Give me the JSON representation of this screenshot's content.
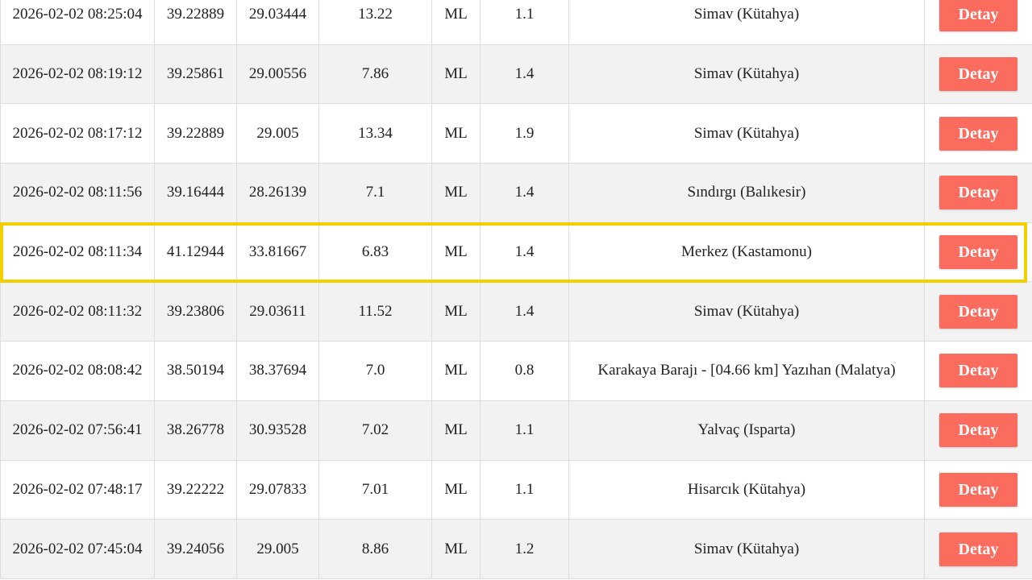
{
  "highlight_color": "#f2d000",
  "button_color": "#fb6b5e",
  "highlighted_row_index": 4,
  "rows": [
    {
      "date": "2026-02-02 08:25:04",
      "lat": "39.22889",
      "lon": "29.03444",
      "depth": "13.22",
      "type": "ML",
      "mag": "1.1",
      "location": "Simav (Kütahya)",
      "action": "Detay"
    },
    {
      "date": "2026-02-02 08:19:12",
      "lat": "39.25861",
      "lon": "29.00556",
      "depth": "7.86",
      "type": "ML",
      "mag": "1.4",
      "location": "Simav (Kütahya)",
      "action": "Detay"
    },
    {
      "date": "2026-02-02 08:17:12",
      "lat": "39.22889",
      "lon": "29.005",
      "depth": "13.34",
      "type": "ML",
      "mag": "1.9",
      "location": "Simav (Kütahya)",
      "action": "Detay"
    },
    {
      "date": "2026-02-02 08:11:56",
      "lat": "39.16444",
      "lon": "28.26139",
      "depth": "7.1",
      "type": "ML",
      "mag": "1.4",
      "location": "Sındırgı (Balıkesir)",
      "action": "Detay"
    },
    {
      "date": "2026-02-02 08:11:34",
      "lat": "41.12944",
      "lon": "33.81667",
      "depth": "6.83",
      "type": "ML",
      "mag": "1.4",
      "location": "Merkez (Kastamonu)",
      "action": "Detay"
    },
    {
      "date": "2026-02-02 08:11:32",
      "lat": "39.23806",
      "lon": "29.03611",
      "depth": "11.52",
      "type": "ML",
      "mag": "1.4",
      "location": "Simav (Kütahya)",
      "action": "Detay"
    },
    {
      "date": "2026-02-02 08:08:42",
      "lat": "38.50194",
      "lon": "38.37694",
      "depth": "7.0",
      "type": "ML",
      "mag": "0.8",
      "location": "Karakaya Barajı - [04.66 km] Yazıhan (Malatya)",
      "action": "Detay"
    },
    {
      "date": "2026-02-02 07:56:41",
      "lat": "38.26778",
      "lon": "30.93528",
      "depth": "7.02",
      "type": "ML",
      "mag": "1.1",
      "location": "Yalvaç (Isparta)",
      "action": "Detay"
    },
    {
      "date": "2026-02-02 07:48:17",
      "lat": "39.22222",
      "lon": "29.07833",
      "depth": "7.01",
      "type": "ML",
      "mag": "1.1",
      "location": "Hisarcık (Kütahya)",
      "action": "Detay"
    },
    {
      "date": "2026-02-02 07:45:04",
      "lat": "39.24056",
      "lon": "29.005",
      "depth": "8.86",
      "type": "ML",
      "mag": "1.2",
      "location": "Simav (Kütahya)",
      "action": "Detay"
    }
  ]
}
